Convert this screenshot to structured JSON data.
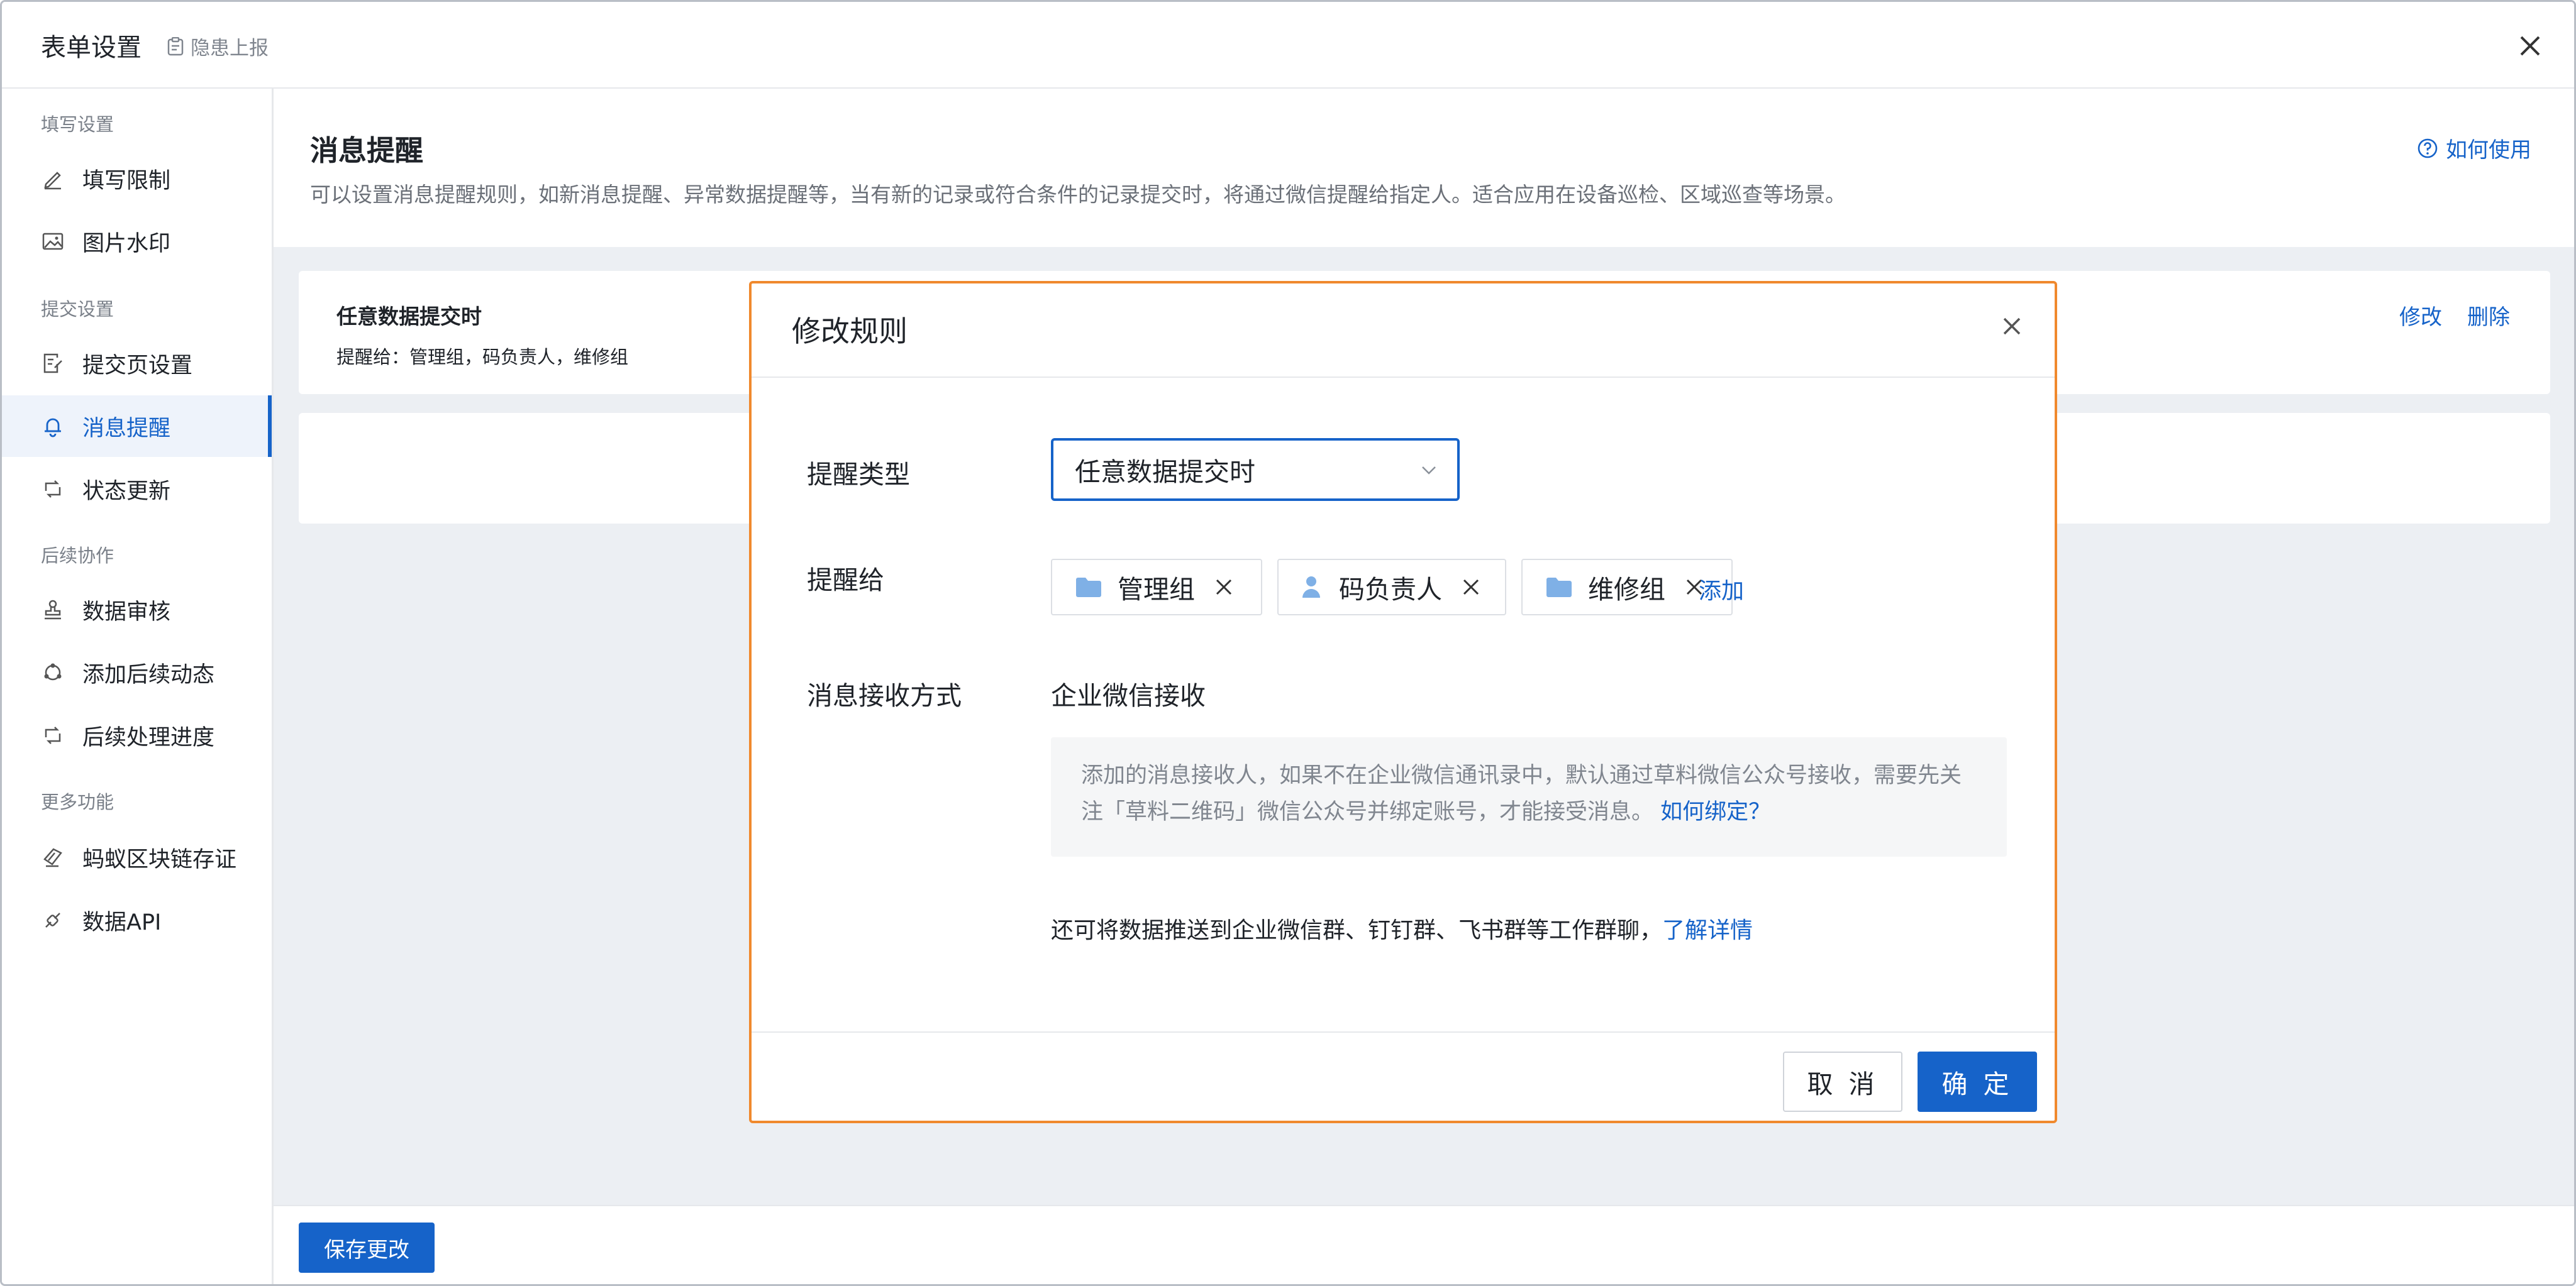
{
  "header": {
    "title": "表单设置",
    "subtitle": "隐患上报"
  },
  "sidebar": {
    "groups": [
      {
        "label": "填写设置",
        "items": [
          {
            "label": "填写限制",
            "icon": "pencil-icon"
          },
          {
            "label": "图片水印",
            "icon": "image-icon"
          }
        ]
      },
      {
        "label": "提交设置",
        "items": [
          {
            "label": "提交页设置",
            "icon": "edit-document-icon"
          },
          {
            "label": "消息提醒",
            "icon": "bell-icon",
            "active": true
          },
          {
            "label": "状态更新",
            "icon": "refresh-icon"
          }
        ]
      },
      {
        "label": "后续协作",
        "items": [
          {
            "label": "数据审核",
            "icon": "stamp-icon"
          },
          {
            "label": "添加后续动态",
            "icon": "sync-icon"
          },
          {
            "label": "后续处理进度",
            "icon": "refresh-icon"
          }
        ]
      },
      {
        "label": "更多功能",
        "items": [
          {
            "label": "蚂蚁区块链存证",
            "icon": "blockchain-icon"
          },
          {
            "label": "数据API",
            "icon": "link-icon"
          }
        ]
      }
    ]
  },
  "main": {
    "title": "消息提醒",
    "description": "可以设置消息提醒规则，如新消息提醒、异常数据提醒等，当有新的记录或符合条件的记录提交时，将通过微信提醒给指定人。适合应用在设备巡检、区域巡查等场景。",
    "help_label": "如何使用",
    "rule": {
      "title": "任意数据提交时",
      "recipients": "提醒给：管理组，码负责人，维修组",
      "edit_label": "修改",
      "delete_label": "删除"
    },
    "save_label": "保存更改"
  },
  "modal": {
    "title": "修改规则",
    "type_label": "提醒类型",
    "type_value": "任意数据提交时",
    "remind_label": "提醒给",
    "recipients": [
      {
        "label": "管理组",
        "icon": "folder-icon"
      },
      {
        "label": "码负责人",
        "icon": "user-icon"
      },
      {
        "label": "维修组",
        "icon": "folder-icon"
      }
    ],
    "add_label": "添加",
    "receive_label": "消息接收方式",
    "receive_value": "企业微信接收",
    "note_text": "添加的消息接收人，如果不在企业微信通讯录中，默认通过草料微信公众号接收，需要先关注「草料二维码」微信公众号并绑定账号，才能接受消息。",
    "note_link": "如何绑定？",
    "push_text": "还可将数据推送到企业微信群、钉钉群、飞书群等工作群聊，",
    "push_link": "了解详情",
    "cancel_label": "取 消",
    "ok_label": "确 定"
  },
  "colors": {
    "accent": "#1663c9",
    "modal_border": "#f0892d",
    "background": "#eceff3"
  }
}
